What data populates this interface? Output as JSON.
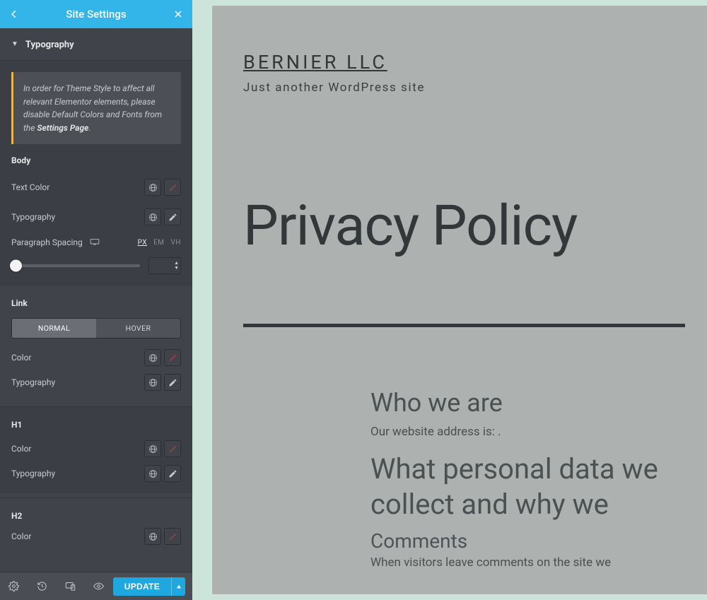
{
  "header": {
    "title": "Site Settings"
  },
  "section": {
    "title": "Typography"
  },
  "notice": {
    "text_prefix": "In order for Theme Style to affect all relevant Elementor elements, please disable Default Colors and Fonts from the ",
    "link_text": "Settings Page",
    "text_suffix": "."
  },
  "body_group": {
    "title": "Body",
    "text_color_label": "Text Color",
    "typography_label": "Typography",
    "paragraph_spacing_label": "Paragraph Spacing",
    "units": {
      "px": "PX",
      "em": "EM",
      "vh": "VH"
    }
  },
  "link_group": {
    "title": "Link",
    "tab_normal": "NORMAL",
    "tab_hover": "HOVER",
    "color_label": "Color",
    "typography_label": "Typography"
  },
  "h1_group": {
    "title": "H1",
    "color_label": "Color",
    "typography_label": "Typography"
  },
  "h2_group": {
    "title": "H2",
    "color_label": "Color"
  },
  "footer": {
    "update": "UPDATE"
  },
  "preview": {
    "site_title": "BERNIER LLC",
    "tagline": "Just another WordPress site",
    "page_title": "Privacy Policy",
    "h_who": "Who we are",
    "p_who": "Our website address is: .",
    "h_data": "What personal data we collect and why we ",
    "h_comments": "Comments",
    "p_comments": "When visitors leave comments on the site we"
  }
}
